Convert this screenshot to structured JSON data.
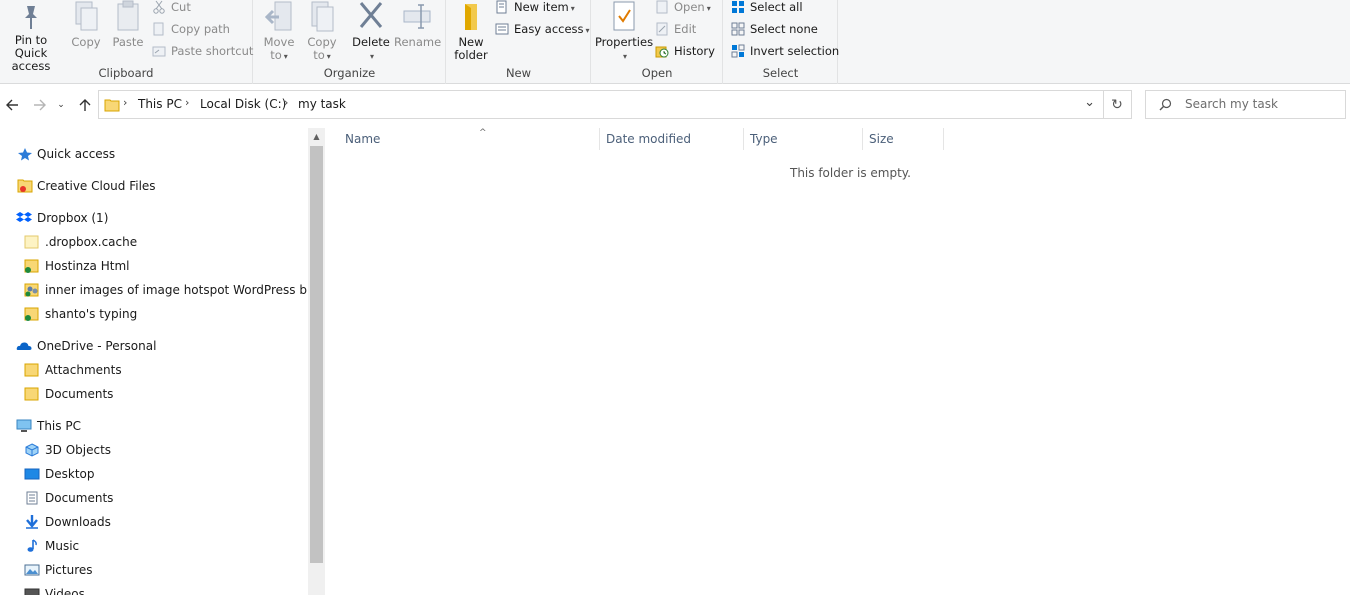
{
  "ribbon": {
    "clipboard": {
      "label": "Clipboard",
      "pin_line1": "Pin to Quick",
      "pin_line2": "access",
      "copy": "Copy",
      "paste": "Paste",
      "cut": "Cut",
      "copy_path": "Copy path",
      "paste_shortcut": "Paste shortcut"
    },
    "organize": {
      "label": "Organize",
      "move_line1": "Move",
      "move_line2": "to",
      "copy_line1": "Copy",
      "copy_line2": "to",
      "delete": "Delete",
      "rename": "Rename"
    },
    "new": {
      "label": "New",
      "folder_line1": "New",
      "folder_line2": "folder",
      "new_item": "New item",
      "easy_access": "Easy access"
    },
    "open": {
      "label": "Open",
      "properties": "Properties",
      "open": "Open",
      "edit": "Edit",
      "history": "History"
    },
    "select": {
      "label": "Select",
      "select_all": "Select all",
      "select_none": "Select none",
      "invert": "Invert selection"
    }
  },
  "address": {
    "crumbs": [
      "This PC",
      "Local Disk (C:)",
      "my task"
    ]
  },
  "search": {
    "placeholder": "Search my task"
  },
  "nav": {
    "items": [
      {
        "label": "Quick access",
        "icon": "star-icon"
      },
      {
        "label": "Creative Cloud Files",
        "icon": "creative-cloud-folder-icon"
      },
      {
        "label": "Dropbox (1)",
        "icon": "dropbox-icon"
      },
      {
        "label": ".dropbox.cache",
        "icon": "folder-icon"
      },
      {
        "label": "Hostinza Html",
        "icon": "synced-folder-icon"
      },
      {
        "label": "inner images of image hotspot WordPress blog",
        "icon": "shared-folder-icon"
      },
      {
        "label": "shanto's typing",
        "icon": "synced-folder-icon"
      },
      {
        "label": "OneDrive - Personal",
        "icon": "onedrive-icon"
      },
      {
        "label": "Attachments",
        "icon": "folder-icon"
      },
      {
        "label": "Documents",
        "icon": "folder-icon"
      },
      {
        "label": "This PC",
        "icon": "computer-icon"
      },
      {
        "label": "3D Objects",
        "icon": "3d-objects-icon"
      },
      {
        "label": "Desktop",
        "icon": "desktop-icon"
      },
      {
        "label": "Documents",
        "icon": "documents-icon"
      },
      {
        "label": "Downloads",
        "icon": "downloads-icon"
      },
      {
        "label": "Music",
        "icon": "music-icon"
      },
      {
        "label": "Pictures",
        "icon": "pictures-icon"
      },
      {
        "label": "Videos",
        "icon": "videos-icon"
      }
    ]
  },
  "columns": {
    "name": "Name",
    "date_modified": "Date modified",
    "type": "Type",
    "size": "Size"
  },
  "content": {
    "empty_message": "This folder is empty."
  },
  "colors": {
    "accent": "#0078d7",
    "folder": "#f8d775",
    "column_header": "#4c607a"
  }
}
